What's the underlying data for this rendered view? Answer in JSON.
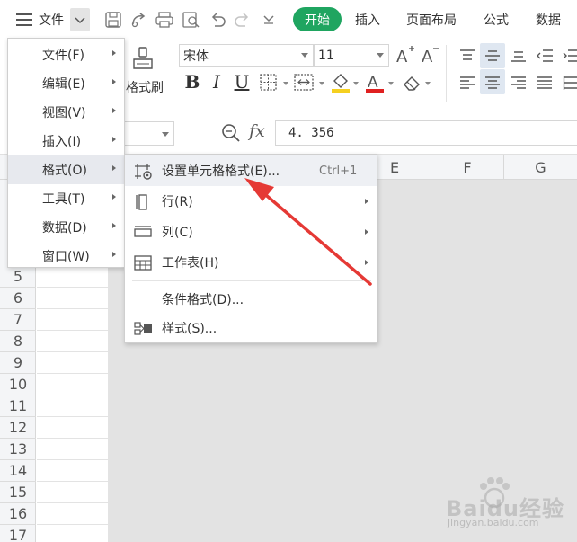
{
  "menubar": {
    "file_label": "文件",
    "tabs": [
      {
        "label": "开始",
        "active": true
      },
      {
        "label": "插入"
      },
      {
        "label": "页面布局"
      },
      {
        "label": "公式"
      },
      {
        "label": "数据"
      }
    ]
  },
  "ribbon": {
    "format_painter_label": "格式刷",
    "font_name": "宋体",
    "font_size": "11",
    "bold": "B",
    "italic": "I",
    "underline": "U",
    "font_color_accent": "#e02020",
    "fill_color_accent": "#f5d020"
  },
  "formula_bar": {
    "fx": "fx",
    "value": "4. 356"
  },
  "sheet": {
    "columns": [
      "E",
      "F",
      "G"
    ],
    "rows": [
      "5",
      "6",
      "7",
      "8",
      "9",
      "10",
      "11",
      "12",
      "13",
      "14",
      "15",
      "16",
      "17"
    ]
  },
  "main_menu": {
    "items": [
      {
        "label": "文件(F)"
      },
      {
        "label": "编辑(E)"
      },
      {
        "label": "视图(V)"
      },
      {
        "label": "插入(I)"
      },
      {
        "label": "格式(O)",
        "active": true
      },
      {
        "label": "工具(T)"
      },
      {
        "label": "数据(D)"
      },
      {
        "label": "窗口(W)"
      }
    ]
  },
  "format_submenu": {
    "items": [
      {
        "label": "设置单元格格式(E)...",
        "shortcut": "Ctrl+1",
        "icon": "cell-format-icon",
        "active": true
      },
      {
        "label": "行(R)",
        "icon": "row-icon",
        "has_submenu": true
      },
      {
        "label": "列(C)",
        "icon": "column-icon",
        "has_submenu": true
      },
      {
        "label": "工作表(H)",
        "icon": "worksheet-icon",
        "has_submenu": true
      },
      {
        "label": "条件格式(D)..."
      },
      {
        "label": "样式(S)...",
        "icon": "style-icon"
      }
    ]
  },
  "annotation": {
    "arrow_color": "#e53935"
  },
  "watermark": {
    "brand": "Baidu经验",
    "url": "jingyan.baidu.com"
  },
  "colors": {
    "accent_green": "#1fa560",
    "menu_highlight": "#e7e9ee",
    "header_bg": "#f4f5f7"
  }
}
